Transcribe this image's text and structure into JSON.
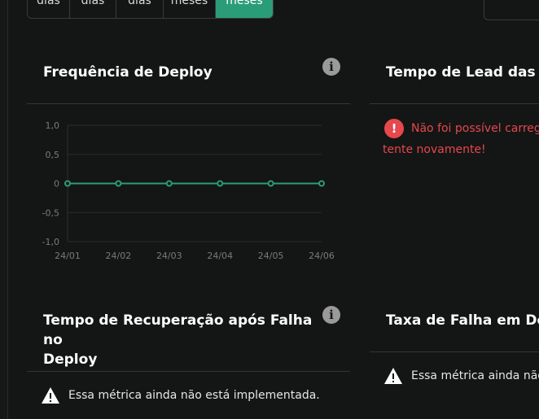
{
  "period_tabs": [
    {
      "label": "dias",
      "active": false
    },
    {
      "label": "dias",
      "active": false
    },
    {
      "label": "dias",
      "active": false
    },
    {
      "label": "meses",
      "active": false
    },
    {
      "label": "meses",
      "active": true
    }
  ],
  "cards": {
    "deploy_frequency": {
      "title": "Frequência de Deploy"
    },
    "lead_time": {
      "title": "Tempo de Lead das M",
      "error_line1": "Não foi possível carrega",
      "error_line2": "tente novamente!"
    },
    "recovery_time": {
      "title_line1": "Tempo de Recuperação após Falha no",
      "title_line2": "Deploy",
      "warning": "Essa métrica ainda não está implementada."
    },
    "failure_rate": {
      "title": "Taxa de Falha em Dep",
      "warning": "Essa métrica ainda não"
    }
  },
  "icons": {
    "info": "info-icon",
    "error": "error-icon",
    "warning": "warning-icon"
  },
  "colors": {
    "accent": "#2a9d78",
    "error": "#e5484d",
    "background": "#141515"
  },
  "chart_data": {
    "type": "line",
    "categories": [
      "24/01",
      "24/02",
      "24/03",
      "24/04",
      "24/05",
      "24/06"
    ],
    "series": [
      {
        "values": [
          0,
          0,
          0,
          0,
          0,
          0
        ]
      }
    ],
    "ylim": [
      -1.0,
      1.0
    ],
    "yticks": [
      "1,0",
      "0,5",
      "0",
      "-0,5",
      "-1,0"
    ],
    "ytick_values": [
      1.0,
      0.5,
      0,
      -0.5,
      -1.0
    ],
    "grid": true
  }
}
